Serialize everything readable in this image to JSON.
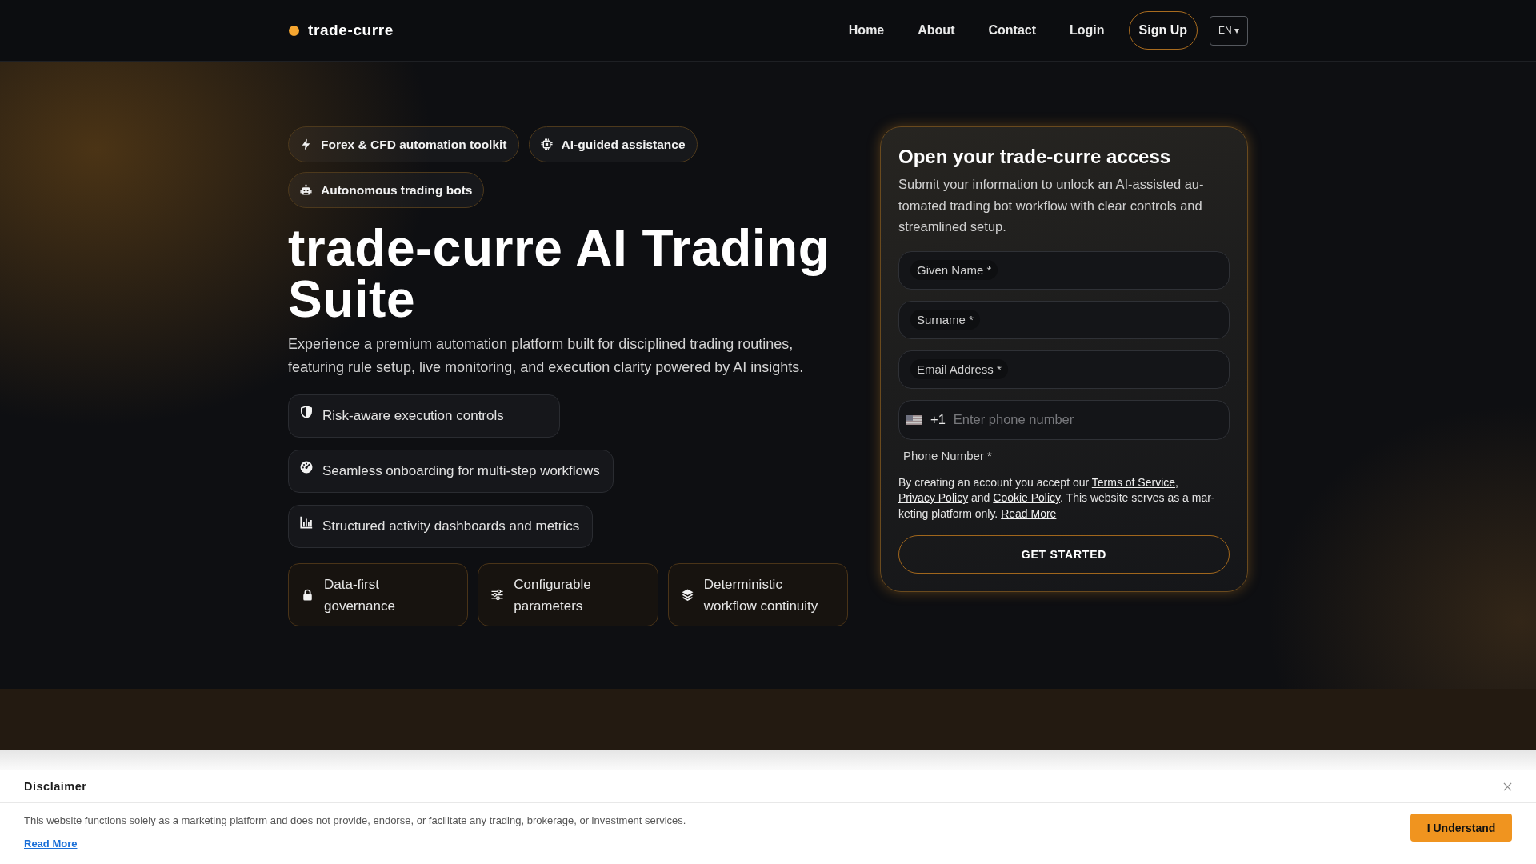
{
  "header": {
    "logo": "trade-curre",
    "nav": [
      {
        "label": "Home"
      },
      {
        "label": "About"
      },
      {
        "label": "Contact"
      },
      {
        "label": "Login"
      }
    ],
    "sign_up": "Sign Up",
    "language": "EN ▾"
  },
  "hero": {
    "tags": [
      {
        "label": "Forex & CFD automation toolkit"
      },
      {
        "label": "AI-guided assistance"
      },
      {
        "label": "Autonomous trading bots"
      }
    ],
    "title": "trade-curre AI Trading Suite",
    "description": "Experience a premium automation platform built for disciplined trading routines, featuring rule setup, live monitoring, and execution clarity powered by AI insights.",
    "features": [
      {
        "label": "Risk-aware execution controls"
      },
      {
        "label": "Seamless onboarding for multi-step workflows"
      },
      {
        "label": "Structured activity dashboards and metrics"
      }
    ],
    "highlights": [
      {
        "label": "Data-first governance"
      },
      {
        "label": "Configurable parameters"
      },
      {
        "label": "Deterministic workflow continuity"
      }
    ]
  },
  "signup_form": {
    "title": "Open your trade-curre access",
    "description": "Submit your information to unlock an AI-assisted au-tomated trading bot workflow with clear controls and streamlined setup.",
    "fields": [
      {
        "label": "Given Name *"
      },
      {
        "label": "Surname *"
      },
      {
        "label": "Email Address *"
      }
    ],
    "phone": {
      "code": "+1",
      "placeholder": "Enter phone number",
      "label": "Phone Number *"
    },
    "consent": [
      {
        "kind": "text",
        "text": "By creating an account you accept our "
      },
      {
        "kind": "link",
        "text": "Terms of Service"
      },
      {
        "kind": "text",
        "text": ", "
      },
      {
        "kind": "link",
        "text": "Privacy Policy"
      },
      {
        "kind": "text",
        "text": " and "
      },
      {
        "kind": "link",
        "text": "Cookie Policy"
      },
      {
        "kind": "text",
        "text": ". This website serves as a mar-keting platform only. "
      },
      {
        "kind": "link",
        "text": "Read More"
      }
    ],
    "submit": "GET STARTED"
  },
  "disclaimer": {
    "title": "Disclaimer",
    "text": "This website functions solely as a marketing platform and does not provide, endorse, or facilitate any trading, brokerage, or investment services.",
    "link": "Read More",
    "button": "I Understand"
  }
}
